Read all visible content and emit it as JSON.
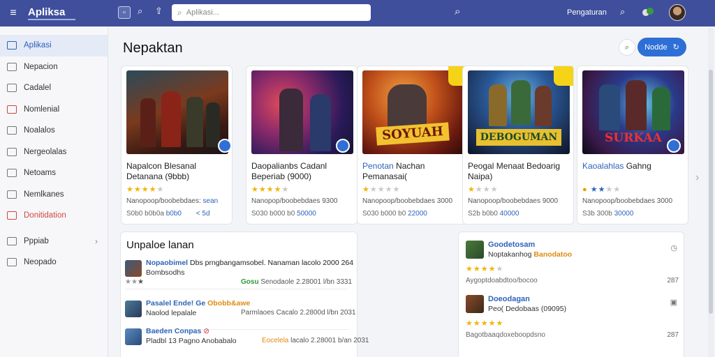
{
  "header": {
    "logo": "Apliksa",
    "search_placeholder": "Aplikasi...",
    "user_label": "Pengaturan"
  },
  "sidebar": {
    "items": [
      {
        "label": "Aplikasi",
        "icon": "apps-icon",
        "state": "active"
      },
      {
        "label": "Nepacion",
        "icon": "list-icon",
        "state": "normal"
      },
      {
        "label": "Cadalel",
        "icon": "page-icon",
        "state": "normal"
      },
      {
        "label": "Nomlenial",
        "icon": "image-icon",
        "state": "normal"
      },
      {
        "label": "Noalalos",
        "icon": "menu-lines-icon",
        "state": "normal"
      },
      {
        "label": "Nergeolalas",
        "icon": "chart-icon",
        "state": "normal"
      },
      {
        "label": "Netoams",
        "icon": "box-icon",
        "state": "normal"
      },
      {
        "label": "Nemlkanes",
        "icon": "folder-icon",
        "state": "normal"
      },
      {
        "label": "Donitidation",
        "icon": "wrench-icon",
        "state": "alert"
      },
      {
        "label": "Pppiab",
        "icon": "grid-icon",
        "state": "expandable"
      },
      {
        "label": "Neopado",
        "icon": "info-icon",
        "state": "normal"
      }
    ]
  },
  "main": {
    "title": "Nepaktan",
    "action_button": "Nodde"
  },
  "cards": [
    {
      "title_pre": "Napalcon Blesanal Detanana (9bbb)",
      "title_blue": "",
      "title_post": "",
      "rating": 4,
      "meta1": "Nanopoop/boobebdaes:",
      "meta1_hl": "sean",
      "meta2": "S0b0 b0b0a",
      "meta2_hl": "b0b0",
      "meta2_end": "< 5d"
    },
    {
      "title_pre": "Daopalianbs Cadanl Beperiab (9000)",
      "title_blue": "",
      "title_post": "",
      "rating": 4,
      "meta1": "Nanopop/boobebdaes 9300",
      "meta1_hl": "",
      "meta2": "S030 b000 b0",
      "meta2_hl": "50000",
      "meta2_end": ""
    },
    {
      "title_pre": "",
      "title_blue": "Penotan",
      "title_post": " Nachan Pemanasai(",
      "rating": 1,
      "meta1": "Nanopoop/boobebdaes 3000",
      "meta1_hl": "",
      "meta2": "S030 b000 b0",
      "meta2_hl": "22000",
      "meta2_end": ""
    },
    {
      "title_pre": "Peogal Menaat Bedoarig Naipa)",
      "title_blue": "",
      "title_post": "",
      "rating": 1,
      "meta1": "Nanopoop/boobebdaes 9000",
      "meta1_hl": "",
      "meta2": "S2b b0b0",
      "meta2_hl": "40000",
      "meta2_end": ""
    },
    {
      "title_pre": "",
      "title_blue": "Kaoalahlas",
      "title_post": " Gahng",
      "rating": 2,
      "meta1": "Nanopoop/boobebdaes 3000",
      "meta1_hl": "",
      "meta2": "S3b 300b",
      "meta2_hl": "30000",
      "meta2_end": ""
    }
  ],
  "updates": {
    "title": "Unpaloe lanan",
    "rows": [
      {
        "name": "Nopaobimel",
        "rest": "Dbs prngbangamsobel. Nanaman lacolo 2000 264",
        "line2": "Bombsodhs",
        "status": "Gosu",
        "detail": "Senodaole 2.28001 l/bn 3331"
      },
      {
        "name": "Pasalel Ende! Ge",
        "accent": "Obobb&awe",
        "rest": "",
        "line2": "Naolod lepalale",
        "status": "",
        "detail": "Parmlaoes Cacalo 2.2800d l/bn 2031"
      },
      {
        "name": "Baeden Conpas",
        "accent": "",
        "rest": "",
        "line2": "Pladbl 13 Pagno Anobabalo",
        "status": "Eocelela",
        "detail": "lacalo 2.28001 b/an 2031"
      }
    ]
  },
  "reviews": {
    "rows": [
      {
        "name": "Goodetosam",
        "sub": "Noptakanhog",
        "accent": "Banodatoo",
        "rating": 4,
        "body": "Aygoptdoabdtoo/bocoo",
        "tag": "287"
      },
      {
        "name": "Doeodagan",
        "sub": "Peo( Dedobaas (09095)",
        "accent": "",
        "rating": 5,
        "body": "Bagotbaaqdoxeboopdsno",
        "tag": "287"
      }
    ]
  },
  "colors": {
    "topbar": "#3f4f9c",
    "accent_blue": "#2d6fd6",
    "star": "#f0b400",
    "alert": "#d14545"
  }
}
